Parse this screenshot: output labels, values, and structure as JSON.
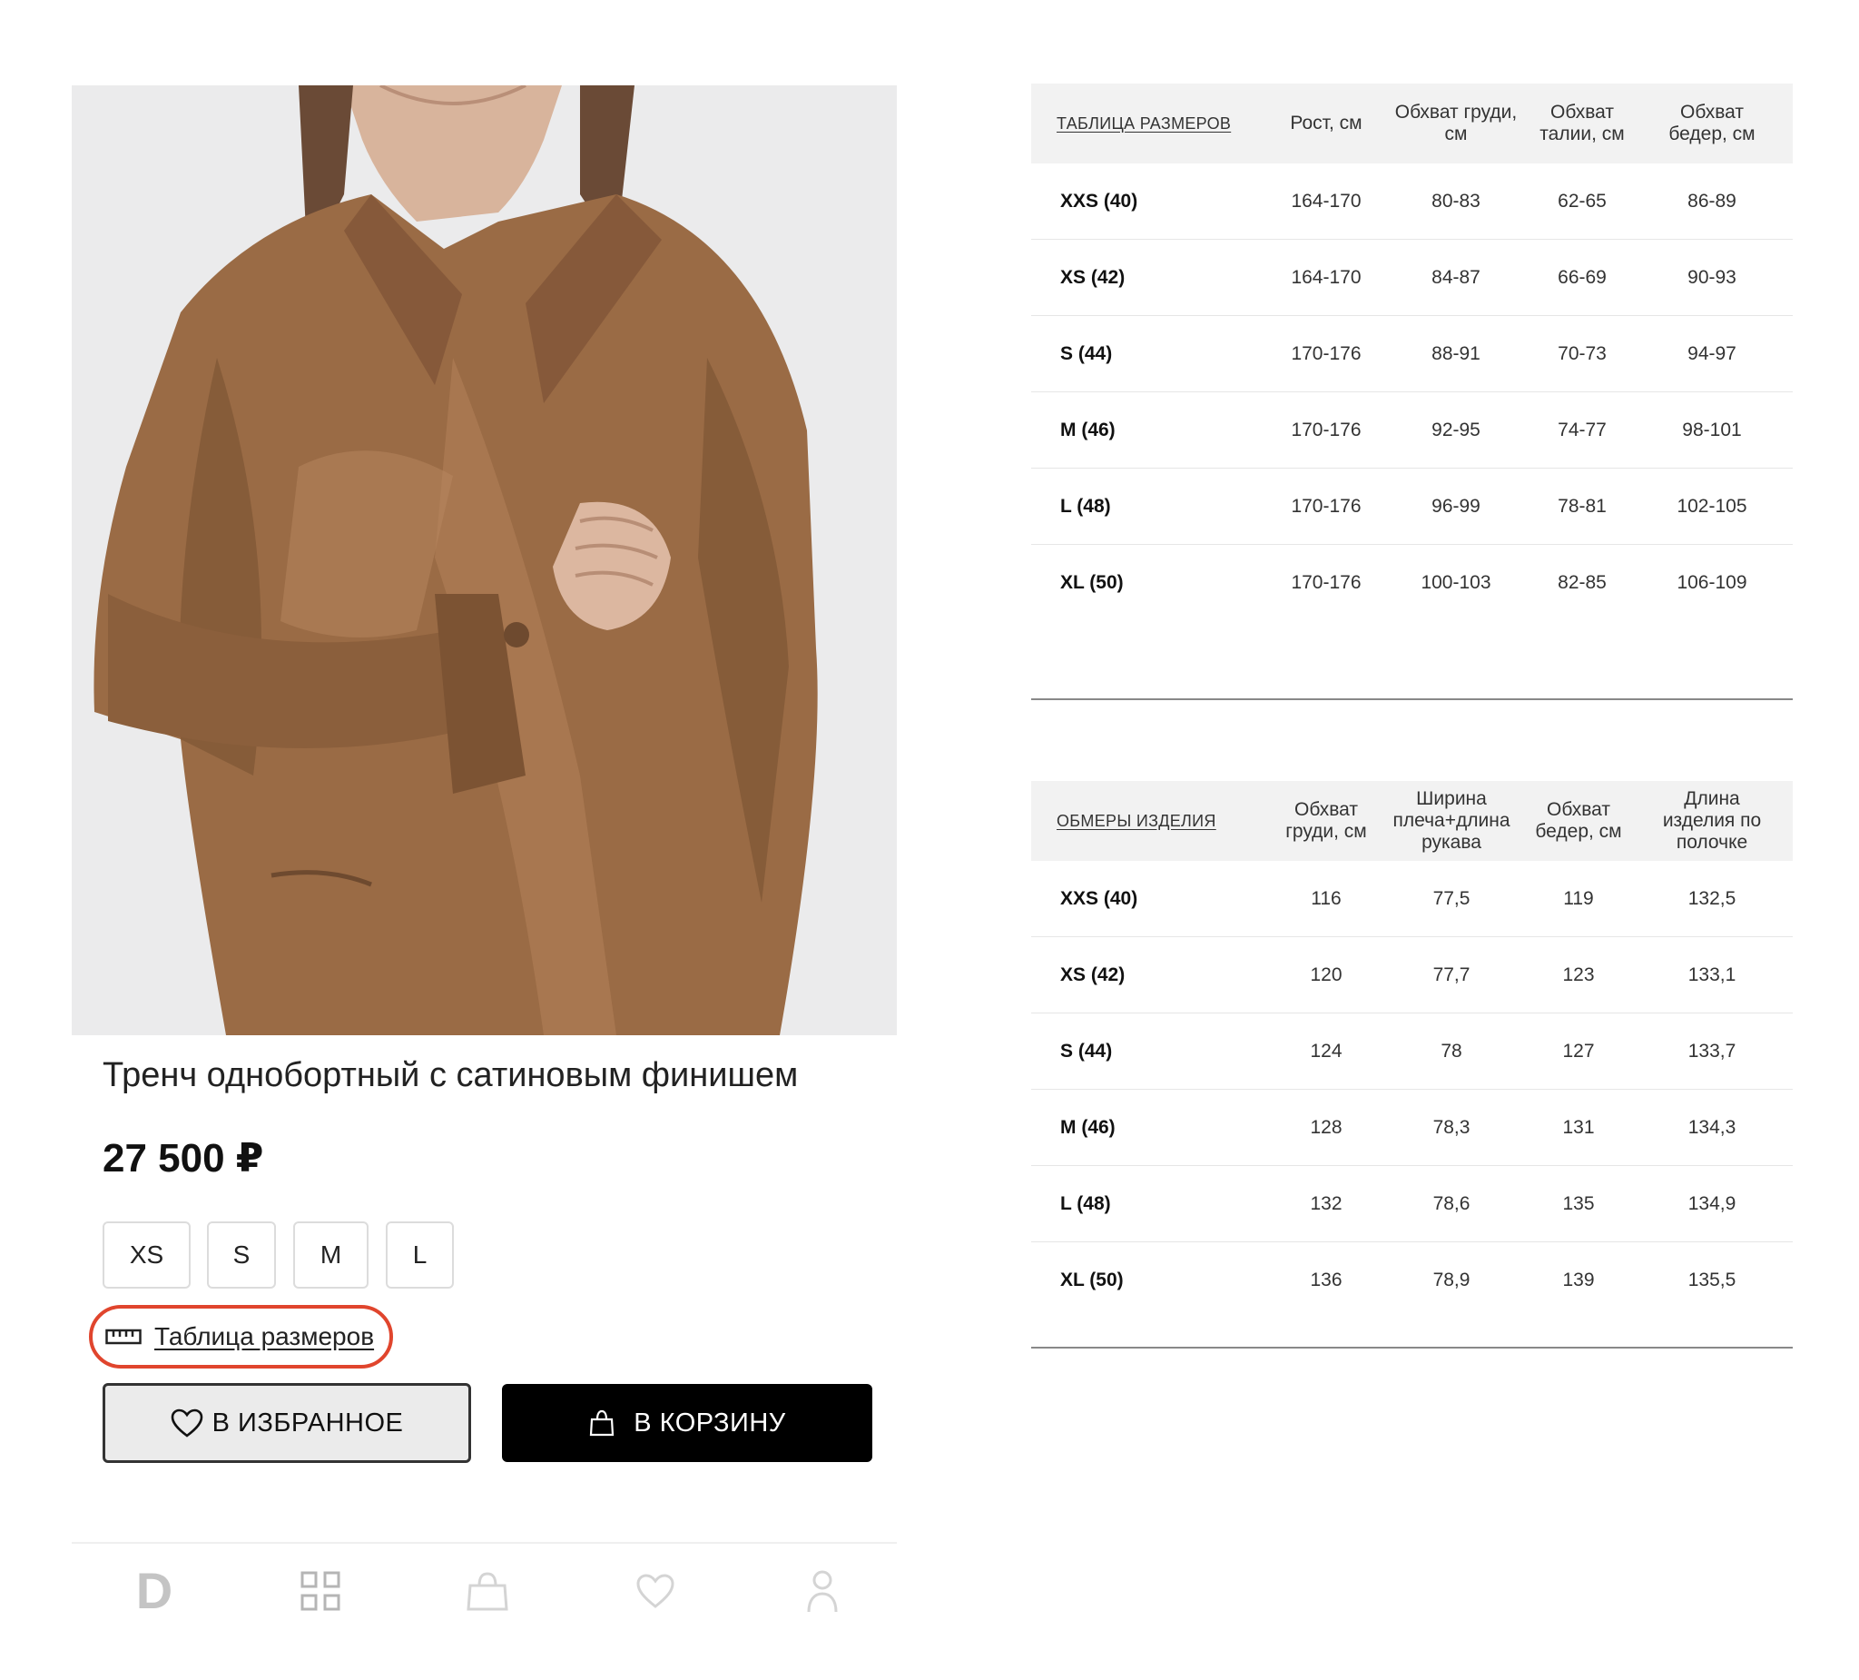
{
  "product": {
    "title": "Тренч однобортный с сатиновым финишем",
    "price": "27 500 ₽",
    "sizes": [
      "XS",
      "S",
      "M",
      "L"
    ],
    "size_guide_label": "Таблица размеров",
    "favorite_label": "В ИЗБРАННОЕ",
    "cart_label": "В КОРЗИНУ"
  },
  "tabbar": {
    "logo": "D",
    "icons": [
      "catalog-icon",
      "bag-icon",
      "heart-icon",
      "profile-icon"
    ]
  },
  "size_table": {
    "title": "ТАБЛИЦА РАЗМЕРОВ",
    "columns": [
      "Рост, см",
      "Обхват груди, см",
      "Обхват талии, см",
      "Обхват бедер, см"
    ],
    "rows": [
      [
        "XXS (40)",
        "164-170",
        "80-83",
        "62-65",
        "86-89"
      ],
      [
        "XS (42)",
        "164-170",
        "84-87",
        "66-69",
        "90-93"
      ],
      [
        "S (44)",
        "170-176",
        "88-91",
        "70-73",
        "94-97"
      ],
      [
        "M (46)",
        "170-176",
        "92-95",
        "74-77",
        "98-101"
      ],
      [
        "L (48)",
        "170-176",
        "96-99",
        "78-81",
        "102-105"
      ],
      [
        "XL (50)",
        "170-176",
        "100-103",
        "82-85",
        "106-109"
      ]
    ]
  },
  "measurements_table": {
    "title": "ОБМЕРЫ ИЗДЕЛИЯ",
    "columns": [
      "Обхват груди, см",
      "Ширина плеча+длина рукава",
      "Обхват бедер, см",
      "Длина изделия по полочке"
    ],
    "rows": [
      [
        "XXS (40)",
        "116",
        "77,5",
        "119",
        "132,5"
      ],
      [
        "XS (42)",
        "120",
        "77,7",
        "123",
        "133,1"
      ],
      [
        "S (44)",
        "124",
        "78",
        "127",
        "133,7"
      ],
      [
        "M (46)",
        "128",
        "78,3",
        "131",
        "134,3"
      ],
      [
        "L (48)",
        "132",
        "78,6",
        "135",
        "134,9"
      ],
      [
        "XL (50)",
        "136",
        "78,9",
        "139",
        "135,5"
      ]
    ]
  },
  "colors": {
    "highlight": "#e0452d",
    "cart_button": "#000000",
    "favorite_button": "#ebebeb",
    "table_header_bg": "#f2f2f2"
  }
}
